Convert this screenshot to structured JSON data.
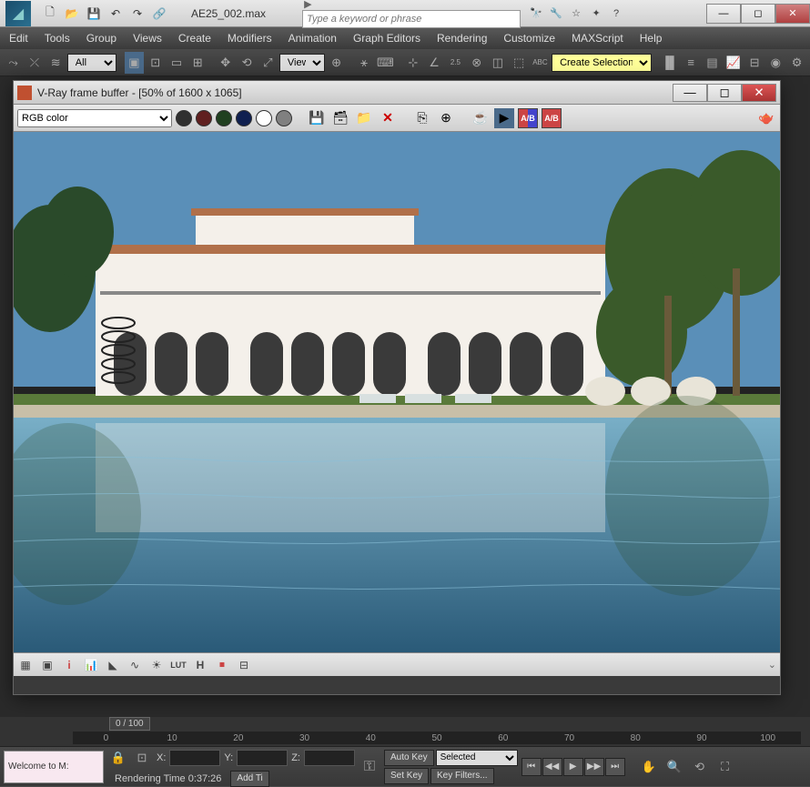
{
  "app": {
    "filename": "AE25_002.max",
    "search_placeholder": "Type a keyword or phrase"
  },
  "menubar": [
    "Edit",
    "Tools",
    "Group",
    "Views",
    "Create",
    "Modifiers",
    "Animation",
    "Graph Editors",
    "Rendering",
    "Customize",
    "MAXScript",
    "Help"
  ],
  "maintoolbar": {
    "filter_select": "All",
    "view_select": "View",
    "selection_set": "Create Selection Se"
  },
  "vray": {
    "title": "V-Ray frame buffer - [50% of 1600 x 1065]",
    "channel_select": "RGB color",
    "swatches": [
      "#303030",
      "#602020",
      "#204020",
      "#102050",
      "#ffffff",
      "#808080"
    ]
  },
  "timeline": {
    "frame": "0 / 100",
    "ticks": [
      "0",
      "10",
      "20",
      "30",
      "40",
      "50",
      "60",
      "70",
      "80",
      "90",
      "100"
    ]
  },
  "bottom": {
    "status": "Welcome to M:",
    "render_status": "Rendering Time  0:37:26",
    "x": "",
    "y": "",
    "z": "",
    "add_time": "Add Ti",
    "auto_key": "Auto Key",
    "set_key": "Set Key",
    "selected": "Selected",
    "key_filters": "Key Filters..."
  }
}
